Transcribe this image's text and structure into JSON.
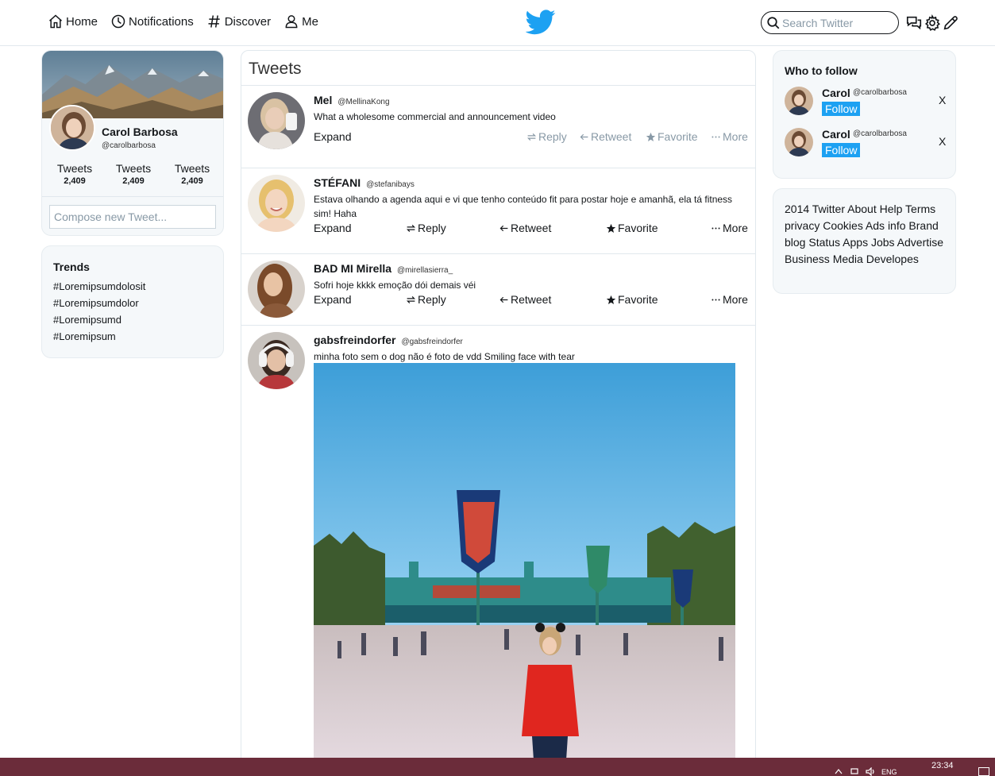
{
  "nav": {
    "home": "Home",
    "notifications": "Notifications",
    "discover": "Discover",
    "me": "Me",
    "search_placeholder": "Search Twitter"
  },
  "profile": {
    "name": "Carol Barbosa",
    "handle": "@carolbarbosa",
    "stats": [
      {
        "label": "Tweets",
        "value": "2,409"
      },
      {
        "label": "Tweets",
        "value": "2,409"
      },
      {
        "label": "Tweets",
        "value": "2,409"
      }
    ],
    "compose_placeholder": "Compose new Tweet..."
  },
  "trends": {
    "title": "Trends",
    "items": [
      "#Loremipsumdolosit",
      "#Loremipsumdolor",
      "#Loremipsumd",
      "#Loremipsum"
    ]
  },
  "timeline": {
    "title": "Tweets",
    "tweets": [
      {
        "name": "Mel",
        "handle": "@MellinaKong",
        "text": "What a wholesome commercial and announcement video",
        "expand": "Expand",
        "reply": "Reply",
        "retweet": "Retweet",
        "favorite": "Favorite",
        "more": "More"
      },
      {
        "name": "STÉFANI",
        "handle": "@stefanibays",
        "text": "Estava olhando a agenda aqui e vi que tenho conteúdo fit para postar hoje e amanhã, ela tá fitness sim! Haha",
        "expand": "Expand",
        "reply": "Reply",
        "retweet": "Retweet",
        "favorite": "Favorite",
        "more": "More"
      },
      {
        "name": "BAD MI Mirella",
        "handle": "@mirellasierra_",
        "text": "Sofri hoje kkkk emoção dói demais véi",
        "expand": "Expand",
        "reply": "Reply",
        "retweet": "Retweet",
        "favorite": "Favorite",
        "more": "More"
      },
      {
        "name": "gabsfreindorfer",
        "handle": "@gabsfreindorfer",
        "text": "minha foto sem o dog não é foto de vdd Smiling face with tear"
      }
    ]
  },
  "who_to_follow": {
    "title": "Who to follow",
    "items": [
      {
        "name": "Carol",
        "handle": "@carolbarbosa",
        "button": "Follow",
        "close": "X"
      },
      {
        "name": "Carol",
        "handle": "@carolbarbosa",
        "button": "Follow",
        "close": "X"
      }
    ]
  },
  "footer": {
    "text": "2014 Twitter About Help Terms privacy Cookies Ads info Brand blog Status Apps Jobs Advertise Business Media Developes"
  },
  "taskbar": {
    "language": "ENG",
    "time": "23:34"
  },
  "colors": {
    "accent": "#1da1f2",
    "card_bg": "#f5f8fa",
    "taskbar": "#6b2c3a",
    "muted_action": "#8899a6"
  }
}
